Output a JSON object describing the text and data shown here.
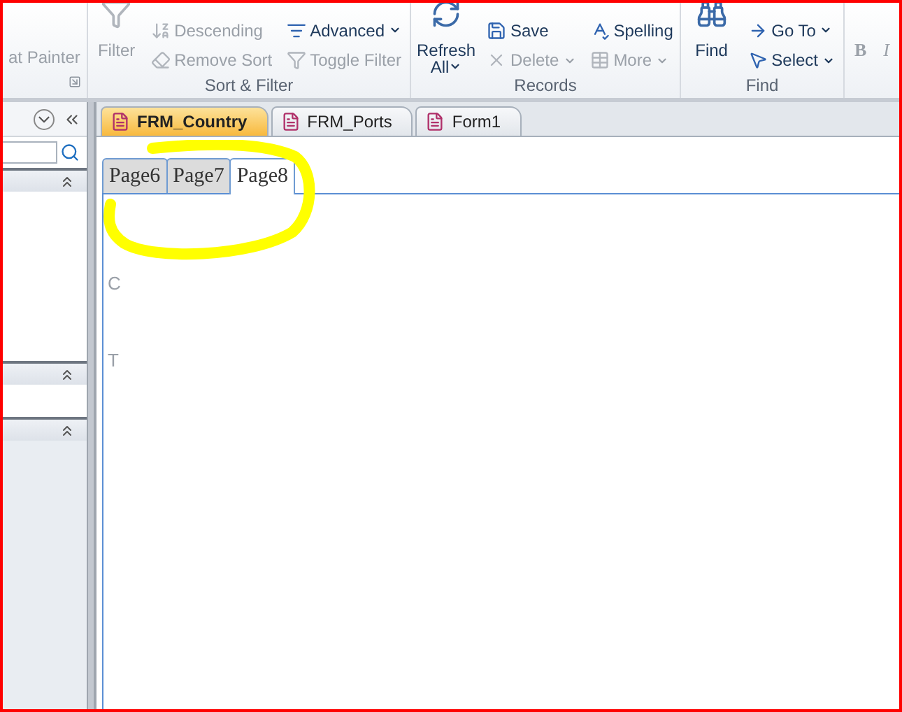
{
  "ribbon": {
    "fragment": {
      "label": "at Painter",
      "disabled": true
    },
    "groups": [
      {
        "label": "Sort & Filter",
        "large": [
          {
            "label": "Filter",
            "disabled": true,
            "dropdown": false
          }
        ],
        "columns": [
          [
            {
              "label": "Descending",
              "disabled": true,
              "dropdown": false
            },
            {
              "label": "Remove Sort",
              "disabled": true,
              "dropdown": false
            }
          ],
          [
            {
              "label": "Advanced",
              "disabled": false,
              "dropdown": true
            },
            {
              "label": "Toggle Filter",
              "disabled": true,
              "dropdown": false
            }
          ]
        ]
      },
      {
        "label": "Records",
        "large": [
          {
            "label": "Refresh All",
            "disabled": false,
            "dropdown": true
          }
        ],
        "columns": [
          [
            {
              "label": "Save",
              "disabled": false,
              "dropdown": false
            },
            {
              "label": "Delete",
              "disabled": true,
              "dropdown": true
            }
          ],
          [
            {
              "label": "Spelling",
              "disabled": false,
              "dropdown": false
            },
            {
              "label": "More",
              "disabled": true,
              "dropdown": true
            }
          ]
        ]
      },
      {
        "label": "Find",
        "large": [
          {
            "label": "Find",
            "disabled": false,
            "dropdown": false
          }
        ],
        "columns": [
          [
            {
              "label": "Go To",
              "disabled": false,
              "dropdown": true
            },
            {
              "label": "Select",
              "disabled": false,
              "dropdown": true
            }
          ]
        ]
      }
    ],
    "format_buttons": [
      {
        "label": "B",
        "disabled": true
      },
      {
        "label": "I",
        "disabled": true
      }
    ]
  },
  "nav_pane": {
    "sections": [
      {
        "expanded": true
      },
      {
        "expanded": true
      },
      {
        "expanded": true
      }
    ]
  },
  "document_tabs": [
    {
      "label": "FRM_Country",
      "selected": true
    },
    {
      "label": "FRM_Ports",
      "selected": false
    },
    {
      "label": "Form1",
      "selected": false
    }
  ],
  "form": {
    "pages": [
      {
        "label": "Page6",
        "selected": false
      },
      {
        "label": "Page7",
        "selected": false
      },
      {
        "label": "Page8",
        "selected": true
      }
    ],
    "label_fragments": [
      "C",
      "T"
    ]
  }
}
